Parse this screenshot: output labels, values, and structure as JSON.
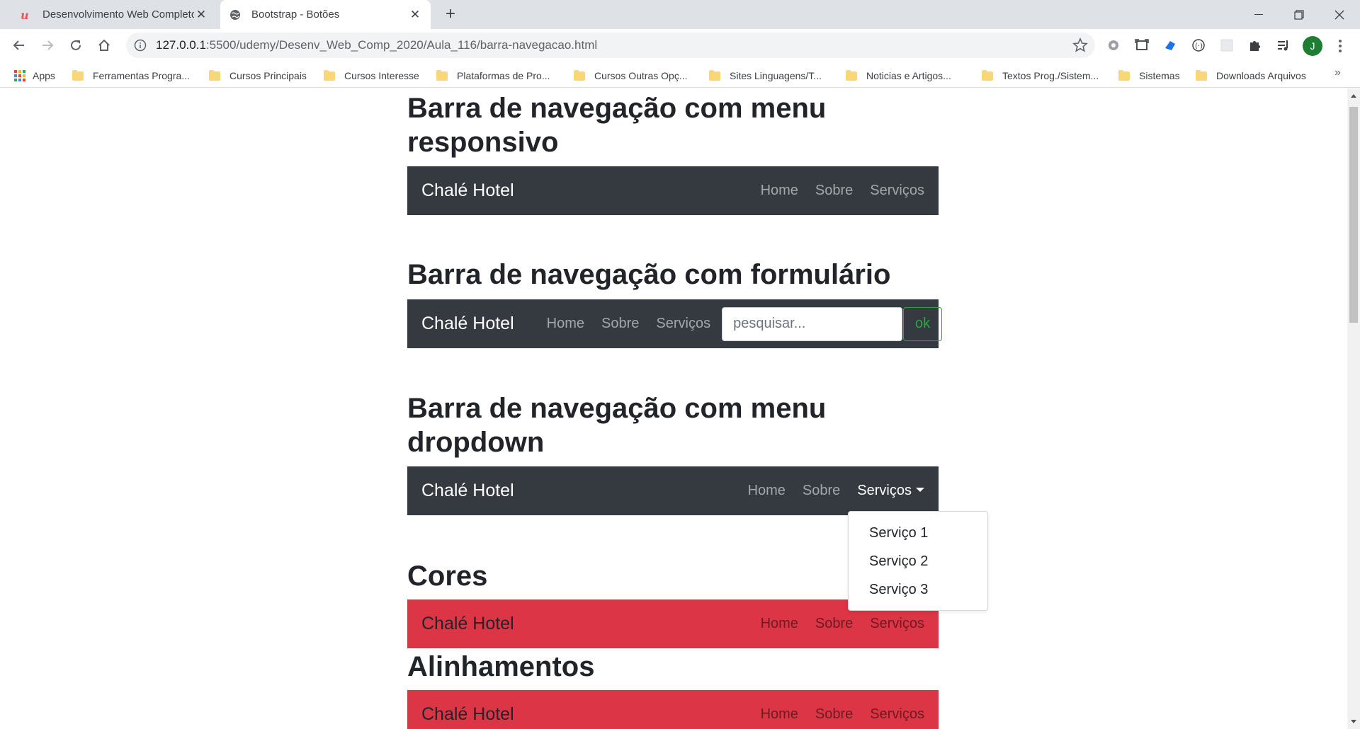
{
  "browser": {
    "tabs": [
      {
        "title": "Desenvolvimento Web Completo",
        "icon": "udemy-icon",
        "active": false
      },
      {
        "title": "Bootstrap - Botões",
        "icon": "globe-icon",
        "active": true
      }
    ],
    "url_host": "127.0.0.1",
    "url_path": ":5500/udemy/Desenv_Web_Comp_2020/Aula_116/barra-navegacao.html",
    "avatar_letter": "J",
    "bookmarks": [
      "Apps",
      "Ferramentas Progra...",
      "Cursos Principais",
      "Cursos Interesse",
      "Plataformas de Pro...",
      "Cursos Outras Opç...",
      "Sites Linguagens/T...",
      "Noticias e Artigos...",
      "Textos Prog./Sistem...",
      "Sistemas",
      "Downloads Arquivos"
    ],
    "bookmarks_more": "»"
  },
  "page": {
    "sections": [
      {
        "title": "Barra de navegação com menu responsivo"
      },
      {
        "title": "Barra de navegação com formulário"
      },
      {
        "title": "Barra de navegação com menu dropdown"
      },
      {
        "title": "Cores"
      },
      {
        "title": "Alinhamentos"
      }
    ],
    "brand": "Chalé Hotel",
    "nav": {
      "home": "Home",
      "sobre": "Sobre",
      "servicos": "Serviços"
    },
    "search": {
      "placeholder": "pesquisar...",
      "button": "ok"
    },
    "dropdown_items": [
      "Serviço 1",
      "Serviço 2",
      "Serviço 3"
    ],
    "colors": {
      "dark": "#343a40",
      "danger": "#dc3545",
      "success": "#28a745"
    }
  }
}
